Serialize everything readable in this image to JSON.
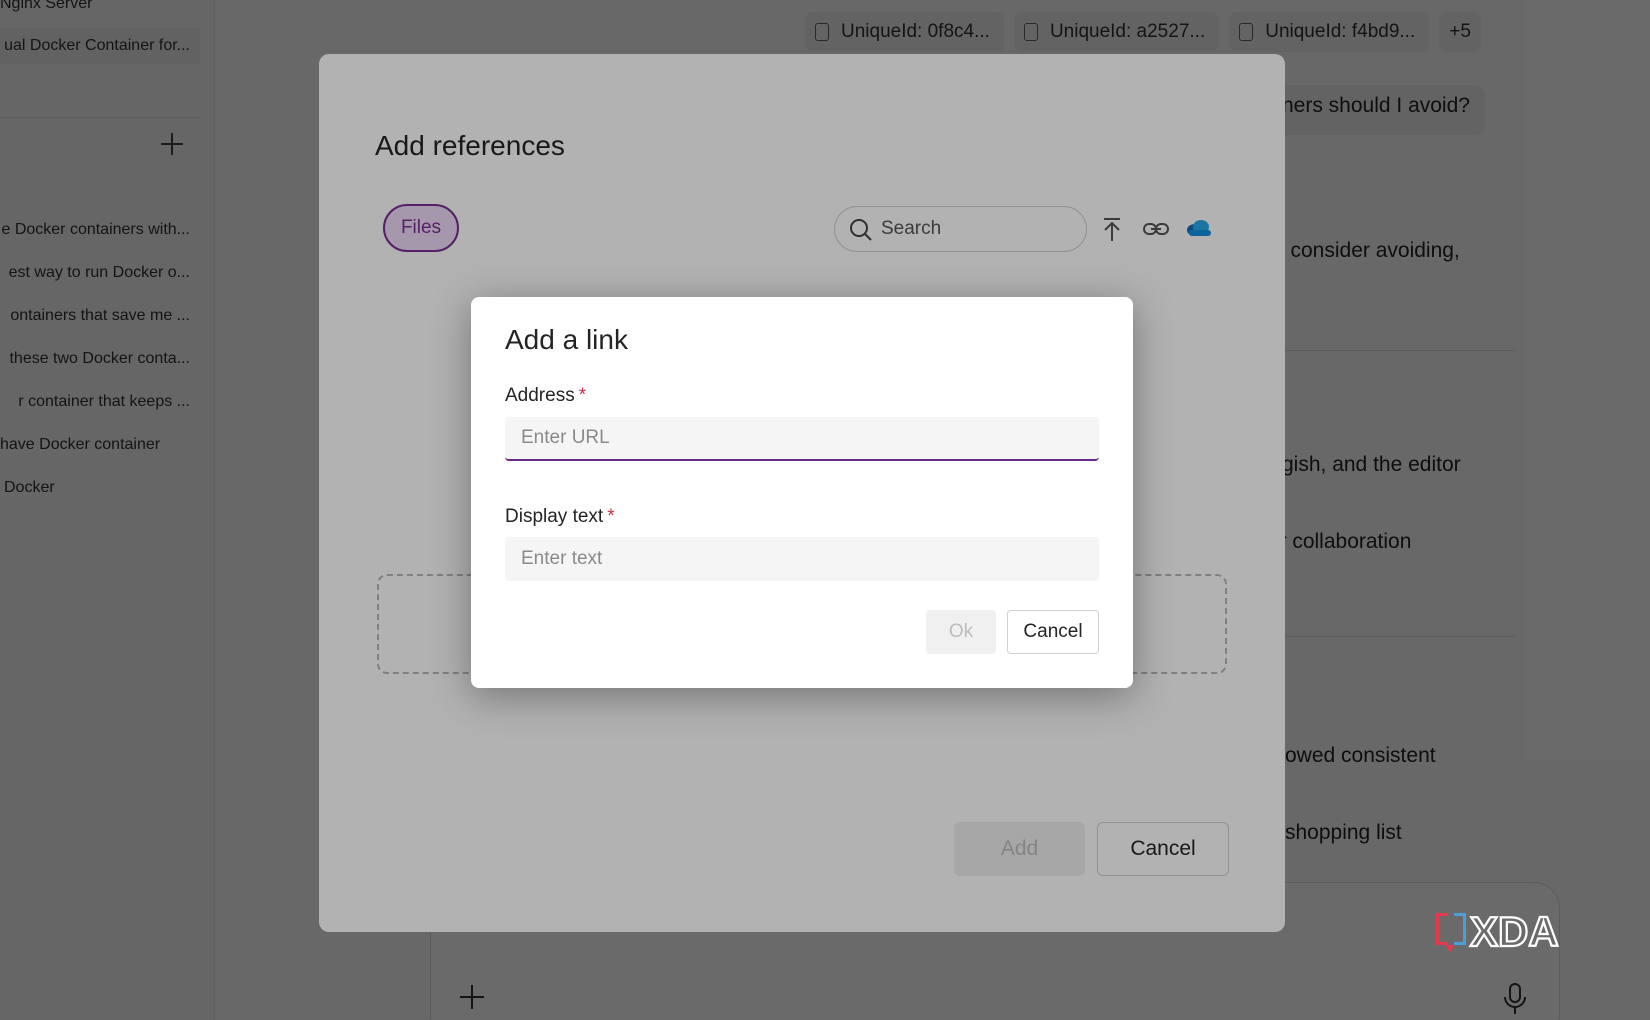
{
  "sidebar": {
    "items": [
      {
        "label": "Nginx Server"
      },
      {
        "label": "ual Docker Container for..."
      },
      {
        "label": "e Docker containers with..."
      },
      {
        "label": "est way to run Docker o..."
      },
      {
        "label": "ontainers that save me ..."
      },
      {
        "label": "these two Docker conta..."
      },
      {
        "label": "r container that keeps ..."
      },
      {
        "label": "have Docker container"
      },
      {
        "label": "Docker"
      }
    ]
  },
  "chips": [
    {
      "label": "UniqueId: 0f8c4..."
    },
    {
      "label": "UniqueId: a2527..."
    },
    {
      "label": "UniqueId: f4bd9..."
    }
  ],
  "chips_more": "+5",
  "chat_fragments": [
    "ners should I avoid?",
    "l consider avoiding,",
    "gish, and the editor",
    "ter collaboration",
    "owed consistent",
    "shopping list"
  ],
  "ref_dialog": {
    "title": "Add references",
    "files_tab": "Files",
    "search_placeholder": "Search",
    "add_label": "Add",
    "cancel_label": "Cancel"
  },
  "link_dialog": {
    "title": "Add a link",
    "address_label": "Address",
    "address_placeholder": "Enter URL",
    "address_value": "",
    "display_label": "Display text",
    "display_placeholder": "Enter text",
    "display_value": "",
    "required_marker": "*",
    "ok_label": "Ok",
    "cancel_label": "Cancel"
  },
  "watermark": "XDA",
  "colors": {
    "accent_purple": "#7b2f92",
    "required_red": "#c4314b",
    "onedrive_blue": "#0f6cbd"
  }
}
